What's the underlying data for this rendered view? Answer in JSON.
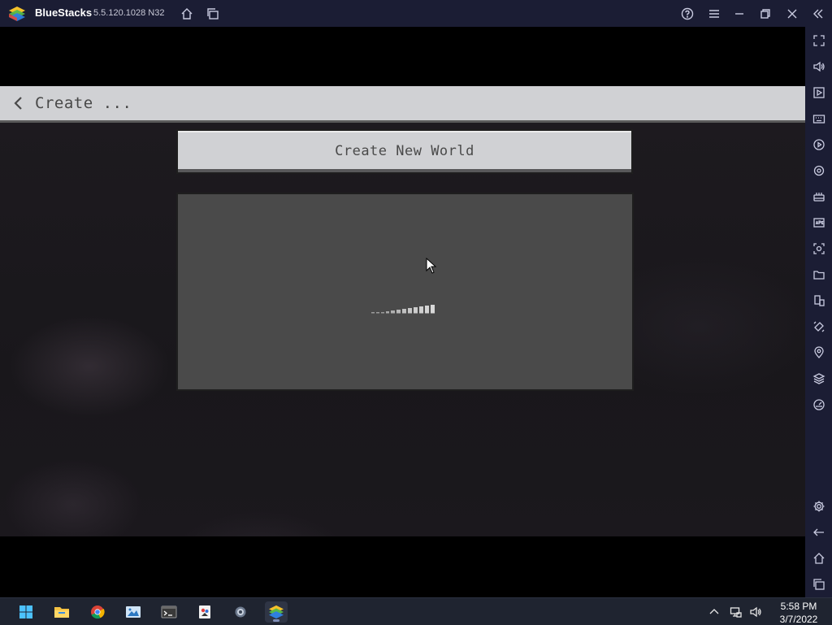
{
  "titlebar": {
    "app_name": "BlueStacks",
    "version": "5.5.120.1028  N32",
    "icons": [
      "home-icon",
      "multi-instance-icon",
      "help-icon",
      "menu-icon",
      "minimize-icon",
      "restore-icon",
      "close-icon",
      "collapse-sidebar-icon"
    ]
  },
  "sidebar": {
    "icons": [
      "fullscreen-icon",
      "volume-icon",
      "media-manager-icon",
      "keyboard-controls-icon",
      "macro-icon",
      "sync-icon",
      "gamepad-icon",
      "install-apk-icon",
      "screenshot-icon",
      "folder-icon",
      "multi-instance-sync-icon",
      "rotate-icon",
      "location-icon",
      "layers-icon",
      "eco-mode-icon",
      "settings-icon",
      "back-icon",
      "home-icon",
      "recent-apps-icon"
    ]
  },
  "game": {
    "header_title": "Create ...",
    "create_button_label": "Create New World",
    "loading": true
  },
  "taskbar": {
    "apps": [
      "start-icon",
      "file-explorer-icon",
      "chrome-icon",
      "photos-icon",
      "terminal-icon",
      "paint-icon",
      "settings-icon",
      "bluestacks-icon"
    ],
    "active_app": "bluestacks-icon",
    "time": "5:58 PM",
    "date": "3/7/2022"
  },
  "colors": {
    "titlebar_bg": "#1b1d34",
    "mc_button_bg": "#d0d1d4",
    "mc_panel_bg": "#4a4a4a",
    "taskbar_bg": "#1f2430"
  }
}
